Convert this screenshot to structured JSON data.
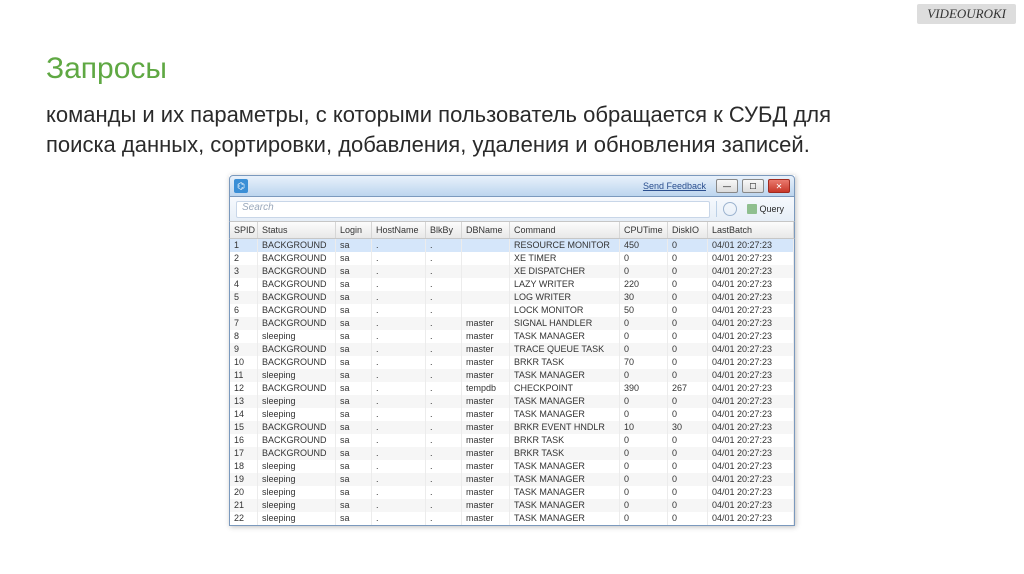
{
  "watermark": "VIDEOUROKI",
  "page": {
    "title": "Запросы",
    "description": "команды и их параметры, с которыми пользователь обращается к СУБД для поиска данных, сортировки, добавления, удаления и обновления записей."
  },
  "window": {
    "feedback_link": "Send Feedback",
    "search_placeholder": "Search",
    "query_button": "Query"
  },
  "columns": [
    "SPID",
    "Status",
    "Login",
    "HostName",
    "BlkBy",
    "DBName",
    "Command",
    "CPUTime",
    "DiskIO",
    "LastBatch"
  ],
  "rows": [
    {
      "spid": "1",
      "status": "BACKGROUND",
      "login": "sa",
      "host": ".",
      "blkby": ".",
      "db": "",
      "cmd": "RESOURCE MONITOR",
      "cpu": "450",
      "disk": "0",
      "last": "04/01 20:27:23",
      "sel": true
    },
    {
      "spid": "2",
      "status": "BACKGROUND",
      "login": "sa",
      "host": ".",
      "blkby": ".",
      "db": "",
      "cmd": "XE TIMER",
      "cpu": "0",
      "disk": "0",
      "last": "04/01 20:27:23"
    },
    {
      "spid": "3",
      "status": "BACKGROUND",
      "login": "sa",
      "host": ".",
      "blkby": ".",
      "db": "",
      "cmd": "XE DISPATCHER",
      "cpu": "0",
      "disk": "0",
      "last": "04/01 20:27:23"
    },
    {
      "spid": "4",
      "status": "BACKGROUND",
      "login": "sa",
      "host": ".",
      "blkby": ".",
      "db": "",
      "cmd": "LAZY WRITER",
      "cpu": "220",
      "disk": "0",
      "last": "04/01 20:27:23"
    },
    {
      "spid": "5",
      "status": "BACKGROUND",
      "login": "sa",
      "host": ".",
      "blkby": ".",
      "db": "",
      "cmd": "LOG WRITER",
      "cpu": "30",
      "disk": "0",
      "last": "04/01 20:27:23"
    },
    {
      "spid": "6",
      "status": "BACKGROUND",
      "login": "sa",
      "host": ".",
      "blkby": ".",
      "db": "",
      "cmd": "LOCK MONITOR",
      "cpu": "50",
      "disk": "0",
      "last": "04/01 20:27:23"
    },
    {
      "spid": "7",
      "status": "BACKGROUND",
      "login": "sa",
      "host": ".",
      "blkby": ".",
      "db": "master",
      "cmd": "SIGNAL HANDLER",
      "cpu": "0",
      "disk": "0",
      "last": "04/01 20:27:23"
    },
    {
      "spid": "8",
      "status": "sleeping",
      "login": "sa",
      "host": ".",
      "blkby": ".",
      "db": "master",
      "cmd": "TASK MANAGER",
      "cpu": "0",
      "disk": "0",
      "last": "04/01 20:27:23"
    },
    {
      "spid": "9",
      "status": "BACKGROUND",
      "login": "sa",
      "host": ".",
      "blkby": ".",
      "db": "master",
      "cmd": "TRACE QUEUE TASK",
      "cpu": "0",
      "disk": "0",
      "last": "04/01 20:27:23"
    },
    {
      "spid": "10",
      "status": "BACKGROUND",
      "login": "sa",
      "host": ".",
      "blkby": ".",
      "db": "master",
      "cmd": "BRKR TASK",
      "cpu": "70",
      "disk": "0",
      "last": "04/01 20:27:23"
    },
    {
      "spid": "11",
      "status": "sleeping",
      "login": "sa",
      "host": ".",
      "blkby": ".",
      "db": "master",
      "cmd": "TASK MANAGER",
      "cpu": "0",
      "disk": "0",
      "last": "04/01 20:27:23"
    },
    {
      "spid": "12",
      "status": "BACKGROUND",
      "login": "sa",
      "host": ".",
      "blkby": ".",
      "db": "tempdb",
      "cmd": "CHECKPOINT",
      "cpu": "390",
      "disk": "267",
      "last": "04/01 20:27:23"
    },
    {
      "spid": "13",
      "status": "sleeping",
      "login": "sa",
      "host": ".",
      "blkby": ".",
      "db": "master",
      "cmd": "TASK MANAGER",
      "cpu": "0",
      "disk": "0",
      "last": "04/01 20:27:23"
    },
    {
      "spid": "14",
      "status": "sleeping",
      "login": "sa",
      "host": ".",
      "blkby": ".",
      "db": "master",
      "cmd": "TASK MANAGER",
      "cpu": "0",
      "disk": "0",
      "last": "04/01 20:27:23"
    },
    {
      "spid": "15",
      "status": "BACKGROUND",
      "login": "sa",
      "host": ".",
      "blkby": ".",
      "db": "master",
      "cmd": "BRKR EVENT HNDLR",
      "cpu": "10",
      "disk": "30",
      "last": "04/01 20:27:23"
    },
    {
      "spid": "16",
      "status": "BACKGROUND",
      "login": "sa",
      "host": ".",
      "blkby": ".",
      "db": "master",
      "cmd": "BRKR TASK",
      "cpu": "0",
      "disk": "0",
      "last": "04/01 20:27:23"
    },
    {
      "spid": "17",
      "status": "BACKGROUND",
      "login": "sa",
      "host": ".",
      "blkby": ".",
      "db": "master",
      "cmd": "BRKR TASK",
      "cpu": "0",
      "disk": "0",
      "last": "04/01 20:27:23"
    },
    {
      "spid": "18",
      "status": "sleeping",
      "login": "sa",
      "host": ".",
      "blkby": ".",
      "db": "master",
      "cmd": "TASK MANAGER",
      "cpu": "0",
      "disk": "0",
      "last": "04/01 20:27:23"
    },
    {
      "spid": "19",
      "status": "sleeping",
      "login": "sa",
      "host": ".",
      "blkby": ".",
      "db": "master",
      "cmd": "TASK MANAGER",
      "cpu": "0",
      "disk": "0",
      "last": "04/01 20:27:23"
    },
    {
      "spid": "20",
      "status": "sleeping",
      "login": "sa",
      "host": ".",
      "blkby": ".",
      "db": "master",
      "cmd": "TASK MANAGER",
      "cpu": "0",
      "disk": "0",
      "last": "04/01 20:27:23"
    },
    {
      "spid": "21",
      "status": "sleeping",
      "login": "sa",
      "host": ".",
      "blkby": ".",
      "db": "master",
      "cmd": "TASK MANAGER",
      "cpu": "0",
      "disk": "0",
      "last": "04/01 20:27:23"
    },
    {
      "spid": "22",
      "status": "sleeping",
      "login": "sa",
      "host": ".",
      "blkby": ".",
      "db": "master",
      "cmd": "TASK MANAGER",
      "cpu": "0",
      "disk": "0",
      "last": "04/01 20:27:23"
    }
  ]
}
